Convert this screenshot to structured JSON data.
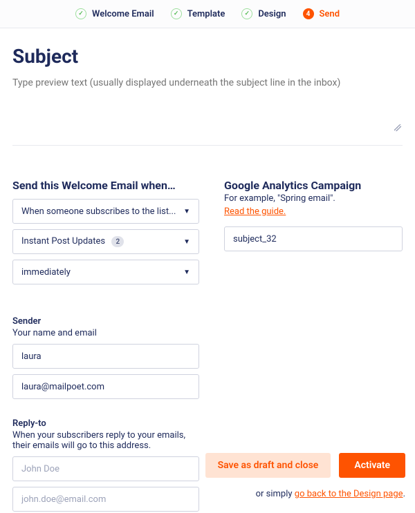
{
  "steps": [
    {
      "label": "Welcome Email",
      "state": "done"
    },
    {
      "label": "Template",
      "state": "done"
    },
    {
      "label": "Design",
      "state": "done"
    },
    {
      "label": "Send",
      "state": "active",
      "badge": "4"
    }
  ],
  "subject": {
    "title": "Subject",
    "preview_placeholder": "Type preview text (usually displayed underneath the subject line in the inbox)"
  },
  "trigger": {
    "title": "Send this Welcome Email when…",
    "select1": "When someone subscribes to the list...",
    "select2_label": "Instant Post Updates",
    "select2_count": "2",
    "select3": "immediately"
  },
  "ga": {
    "title": "Google Analytics Campaign",
    "example": "For example, \"Spring email\".",
    "guide_link": "Read the guide.",
    "value": "subject_32"
  },
  "sender": {
    "title": "Sender",
    "desc": "Your name and email",
    "name_value": "laura",
    "email_value": "laura@mailpoet.com"
  },
  "reply": {
    "title": "Reply-to",
    "desc": "When your subscribers reply to your emails, their emails will go to this address.",
    "name_placeholder": "John Doe",
    "email_placeholder": "john.doe@email.com"
  },
  "footer": {
    "draft_label": "Save as draft and close",
    "activate_label": "Activate",
    "or_text": "or simply ",
    "back_link": "go back to the Design page",
    "period": "."
  }
}
